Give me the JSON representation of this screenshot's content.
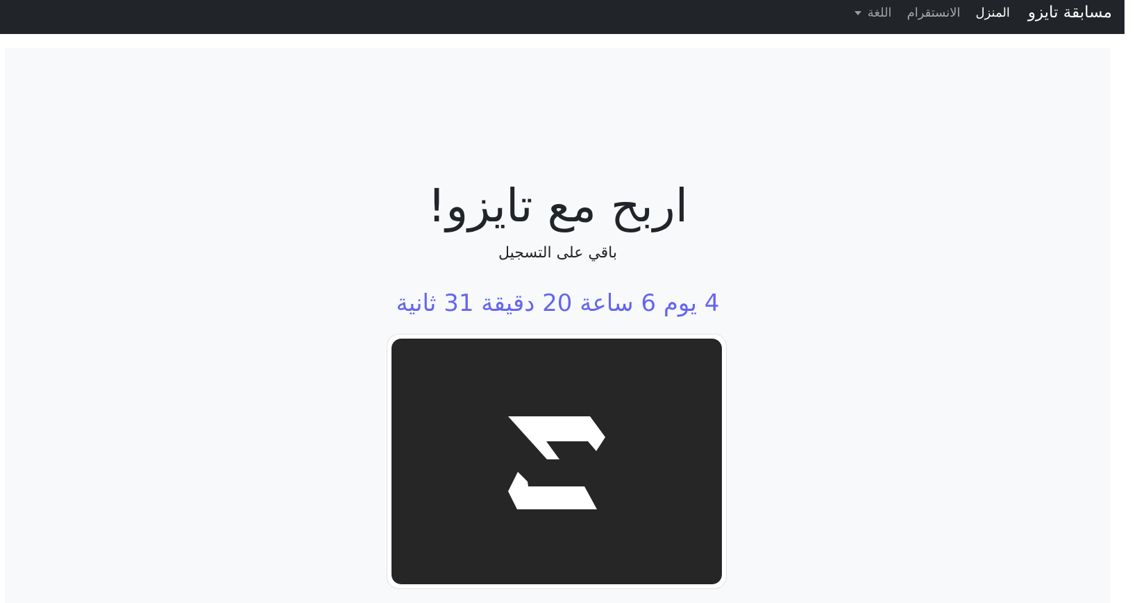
{
  "navbar": {
    "brand": "مسابقة تايزو",
    "links": [
      {
        "label": "المنزل",
        "active": true
      },
      {
        "label": "الانستقرام",
        "active": false
      }
    ],
    "language_dropdown": "اللغة"
  },
  "hero": {
    "title": "اربح مع تايزو!",
    "subtitle": "باقي على التسجيل",
    "countdown": "4 يوم 6 ساعة 20 دقيقة 31 ثانية"
  },
  "logo": {
    "icon": "taizo-logo-icon",
    "background": "#262626",
    "foreground": "#ffffff"
  },
  "colors": {
    "navbar_bg": "#212529",
    "page_bg": "#f8f9fa",
    "countdown": "#6366f1"
  }
}
